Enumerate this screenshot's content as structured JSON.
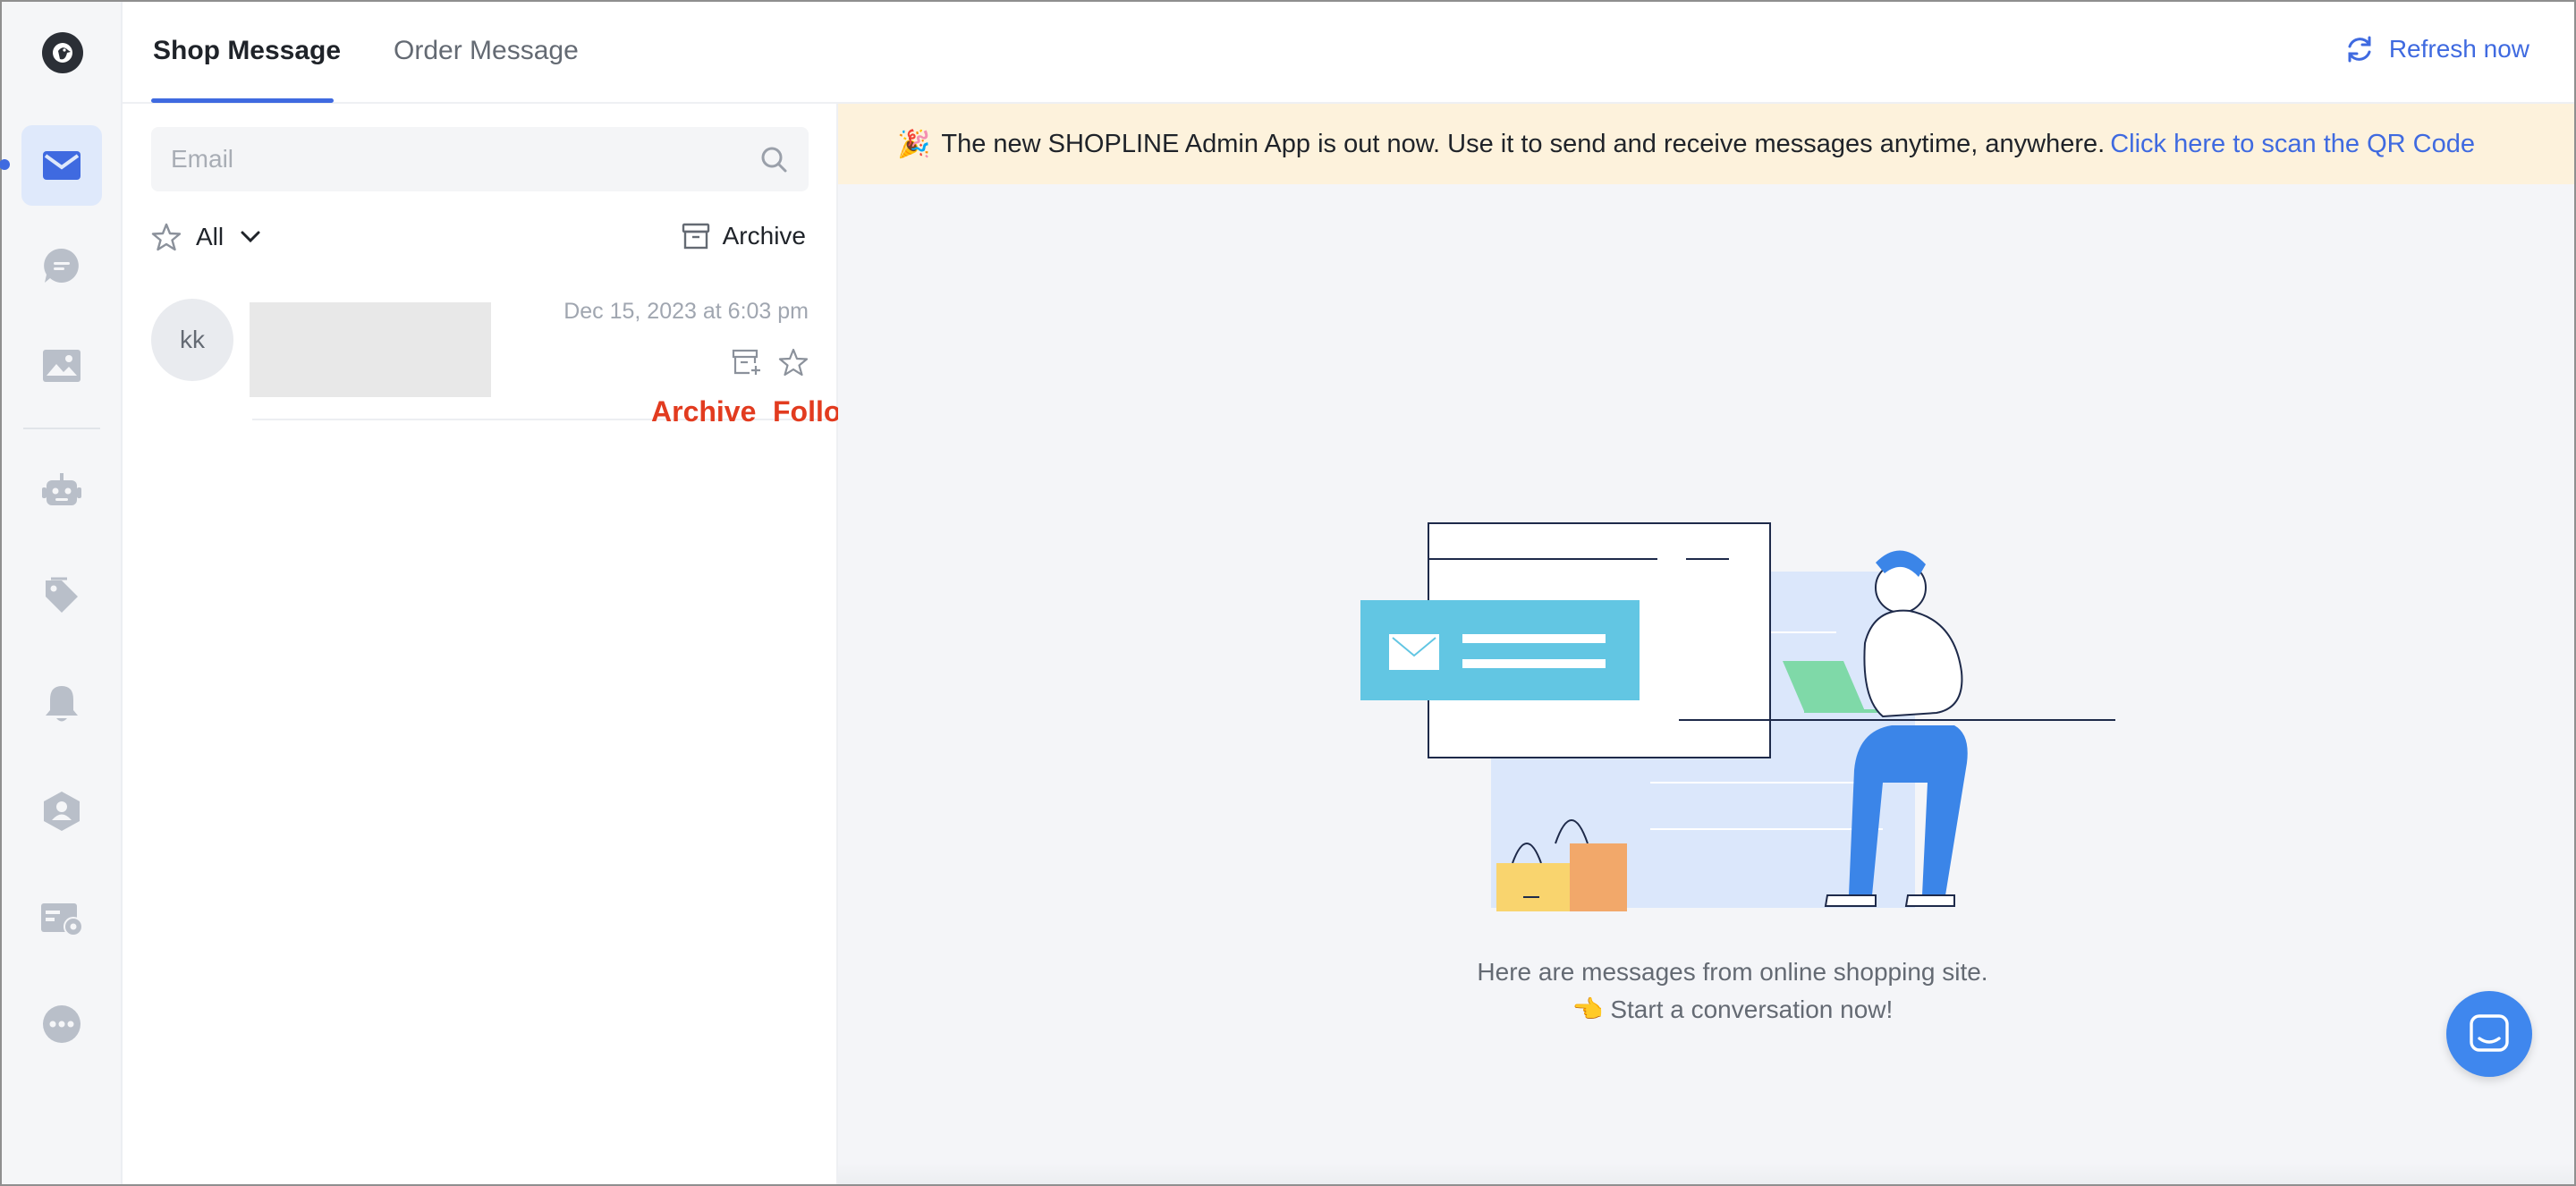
{
  "colors": {
    "accent": "#3f6ae0",
    "banner_bg": "#fdf2dc",
    "annotation": "#e23b1f",
    "fab": "#3f87ee"
  },
  "rail": {
    "logo_icon": "bird-logo-icon",
    "items": [
      {
        "icon": "mail-icon",
        "active": true
      },
      {
        "icon": "chat-bubble-icon"
      },
      {
        "icon": "image-icon"
      },
      {
        "icon": "robot-icon"
      },
      {
        "icon": "tag-icon"
      },
      {
        "icon": "bell-icon"
      },
      {
        "icon": "user-shield-icon"
      },
      {
        "icon": "card-settings-icon"
      },
      {
        "icon": "more-dots-icon"
      }
    ]
  },
  "header": {
    "tabs": [
      {
        "label": "Shop Message",
        "active": true
      },
      {
        "label": "Order Message"
      }
    ],
    "refresh_label": "Refresh now"
  },
  "list": {
    "search": {
      "placeholder": "Email",
      "value": ""
    },
    "filter_label": "All",
    "archive_label": "Archive",
    "conversations": [
      {
        "avatar_text": "kk",
        "timestamp": "Dec 15, 2023 at 6:03 pm"
      }
    ],
    "annotations": {
      "archive": "Archive",
      "follow_up": "Follow-up"
    }
  },
  "banner": {
    "text": "The new SHOPLINE Admin App is out now. Use it to send and receive messages anytime, anywhere.",
    "link": "Click here to scan the QR Code"
  },
  "empty_state": {
    "line1": "Here are messages from online shopping site.",
    "line2": "Start a conversation now!"
  }
}
